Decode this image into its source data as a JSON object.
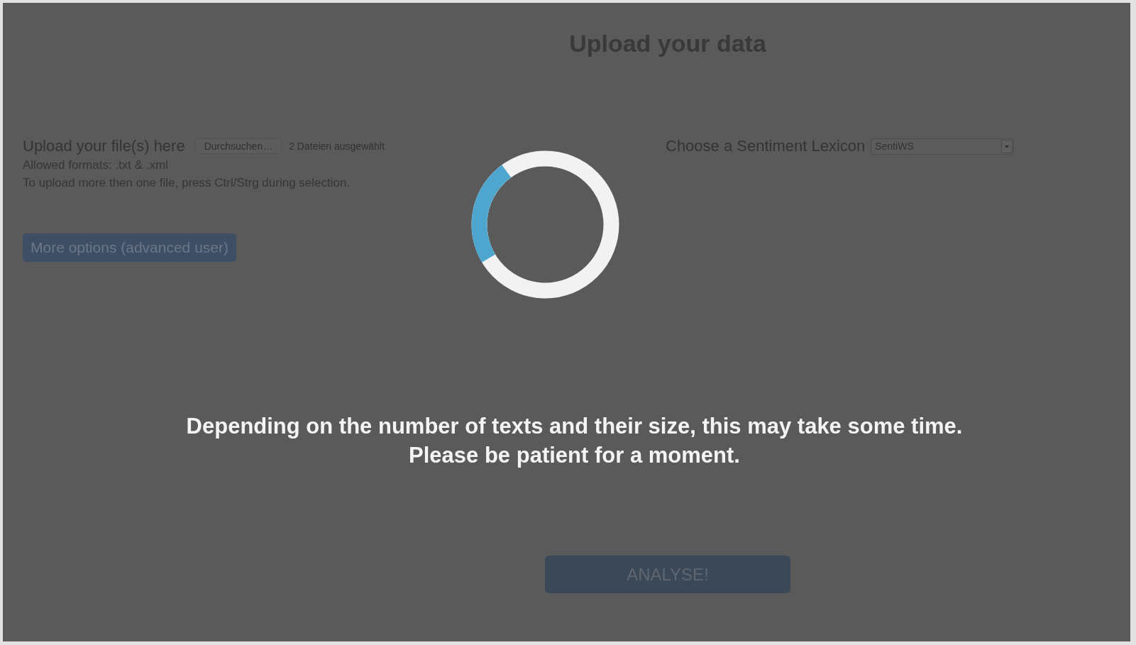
{
  "page": {
    "title": "Upload your data"
  },
  "upload": {
    "label": "Upload your file(s) here",
    "browse_button": "Durchsuchen…",
    "file_status": "2 Dateien ausgewählt.",
    "hints": [
      "Allowed formats: .txt & .xml",
      "To upload more then one file, press Ctrl/Strg during selection."
    ],
    "options_button": "More options (advanced user)"
  },
  "lexicon": {
    "label": "Choose a Sentiment Lexicon",
    "value": "SentiWS"
  },
  "analyse_button": "ANALYSE!",
  "loading_overlay": {
    "message_lines": [
      "Depending on the number of texts and their size, this may take some time.",
      "Please be patient for a moment."
    ]
  }
}
